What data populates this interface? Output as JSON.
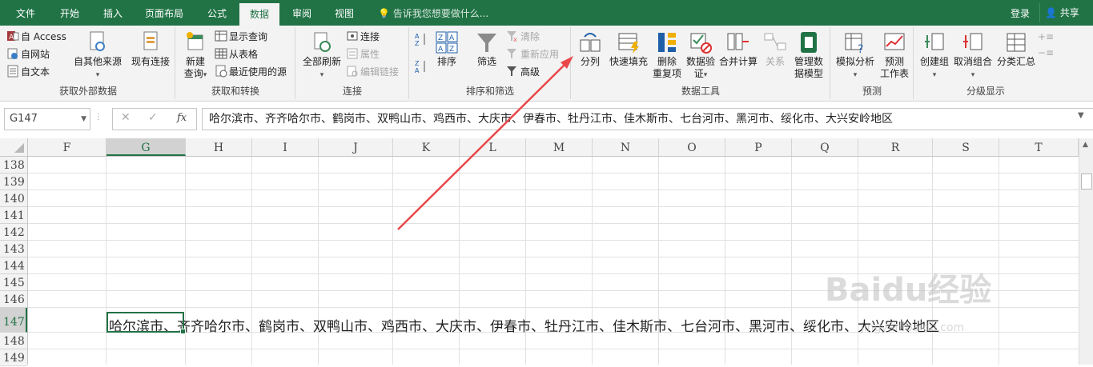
{
  "tabs": [
    {
      "label": "文件",
      "active": false
    },
    {
      "label": "开始",
      "active": false
    },
    {
      "label": "插入",
      "active": false
    },
    {
      "label": "页面布局",
      "active": false
    },
    {
      "label": "公式",
      "active": false
    },
    {
      "label": "数据",
      "active": true
    },
    {
      "label": "审阅",
      "active": false
    },
    {
      "label": "视图",
      "active": false
    }
  ],
  "tell_me": "告诉我您想要做什么...",
  "login": "登录",
  "share": "共享",
  "ribbon": {
    "get_external": {
      "label": "获取外部数据",
      "access": "自 Access",
      "web": "自网站",
      "text": "自文本",
      "other": "自其他来源",
      "existing": "现有连接"
    },
    "get_transform": {
      "label": "获取和转换",
      "new_query": "新建",
      "new_query2": "查询",
      "show_queries": "显示查询",
      "from_table": "从表格",
      "recent": "最近使用的源"
    },
    "connections": {
      "label": "连接",
      "refresh_all": "全部刷新",
      "connections": "连接",
      "properties": "属性",
      "edit_links": "编辑链接"
    },
    "sort_filter": {
      "label": "排序和筛选",
      "sort": "排序",
      "filter": "筛选",
      "clear": "清除",
      "reapply": "重新应用",
      "advanced": "高级"
    },
    "data_tools": {
      "label": "数据工具",
      "text_to_columns": "分列",
      "flash_fill": "快速填充",
      "remove_dup": "删除",
      "remove_dup2": "重复项",
      "validation": "数据验",
      "validation2": "证",
      "consolidate": "合并计算",
      "relationships": "关系",
      "manage_model": "管理数",
      "manage_model2": "据模型"
    },
    "forecast": {
      "label": "预测",
      "what_if": "模拟分析",
      "forecast_sheet": "预测",
      "forecast_sheet2": "工作表"
    },
    "outline": {
      "label": "分级显示",
      "group": "创建组",
      "ungroup": "取消组合",
      "subtotal": "分类汇总"
    }
  },
  "formula_bar": {
    "name_box": "G147",
    "formula": "哈尔滨市、齐齐哈尔市、鹤岗市、双鸭山市、鸡西市、大庆市、伊春市、牡丹江市、佳木斯市、七台河市、黑河市、绥化市、大兴安岭地区"
  },
  "grid": {
    "columns": [
      "F",
      "G",
      "H",
      "I",
      "J",
      "K",
      "L",
      "M",
      "N",
      "O",
      "P",
      "Q",
      "R",
      "S",
      "T"
    ],
    "selected_column": "G",
    "rows": [
      "138",
      "139",
      "140",
      "141",
      "142",
      "143",
      "144",
      "145",
      "146",
      "147",
      "148",
      "149"
    ],
    "selected_row": "147",
    "cell_G147": "哈尔滨市、齐齐哈尔市、鹤岗市、双鸭山市、鸡西市、大庆市、伊春市、牡丹江市、佳木斯市、七台河市、黑河市、绥化市、大兴安岭地区"
  },
  "watermark": "Baidu经验",
  "watermark_url": "jingyan.baidu.com",
  "colors": {
    "accent": "#217346",
    "arrow": "#e8484a"
  }
}
